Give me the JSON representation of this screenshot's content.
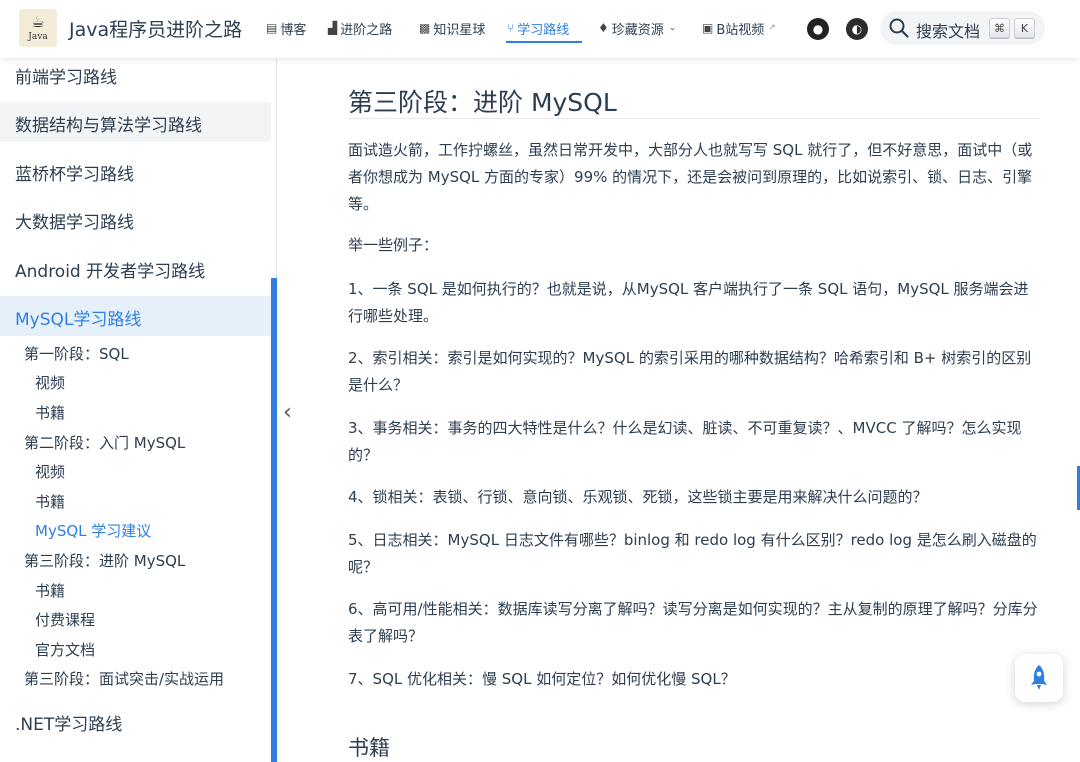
{
  "navbar": {
    "logo_text": "Java",
    "site_title": "Java程序员进阶之路",
    "items": [
      {
        "label": "博客",
        "icon": "document-icon"
      },
      {
        "label": "进阶之路",
        "icon": "chart-icon"
      },
      {
        "label": "知识星球",
        "icon": "planet-icon"
      },
      {
        "label": "学习路线",
        "icon": "path-icon"
      },
      {
        "label": "珍藏资源",
        "icon": "diamond-icon"
      },
      {
        "label": "B站视频",
        "icon": "tv-icon"
      }
    ],
    "search_label": "搜索文档",
    "search_keys": [
      "⌘",
      "K"
    ],
    "accent_color": "#2f7fe0"
  },
  "sidebar": {
    "links": [
      "前端学习路线",
      "数据结构与算法学习路线",
      "蓝桥杯学习路线",
      "大数据学习路线",
      "Android 开发者学习路线",
      "MySQL学习路线",
      ".NET学习路线"
    ],
    "sub_items": [
      "第一阶段：SQL",
      "视频",
      "书籍",
      "第二阶段：入门 MySQL",
      "视频",
      "书籍",
      "MySQL 学习建议",
      "第三阶段：进阶 MySQL",
      "书籍",
      "付费课程",
      "官方文档",
      "第三阶段：面试突击/实战运用"
    ]
  },
  "main": {
    "heading": "第三阶段：进阶 MySQL",
    "intro": "面试造火箭，工作拧螺丝，虽然日常开发中，大部分人也就写写 SQL 就行了，但不好意思，面试中（或者你想成为 MySQL 方面的专家）99% 的情况下，还是会被问到原理的，比如说索引、锁、日志、引擎等。",
    "examples_label": "举一些例子：",
    "items": [
      "1、一条 SQL 是如何执行的？也就是说，从MySQL 客户端执行了一条 SQL 语句，MySQL 服务端会进行哪些处理。",
      "2、索引相关：索引是如何实现的？MySQL 的索引采用的哪种数据结构？哈希索引和 B+ 树索引的区别是什么？",
      "3、事务相关：事务的四大特性是什么？什么是幻读、脏读、不可重复读？、MVCC 了解吗？怎么实现的？",
      "4、锁相关：表锁、行锁、意向锁、乐观锁、死锁，这些锁主要是用来解决什么问题的？",
      "5、日志相关：MySQL 日志文件有哪些？binlog 和 redo log 有什么区别？redo log 是怎么刷入磁盘的呢？",
      "6、高可用/性能相关：数据库读写分离了解吗？读写分离是如何实现的？主从复制的原理了解吗？分库分表了解吗？",
      "7、SQL 优化相关：慢 SQL 如何定位？如何优化慢 SQL？"
    ],
    "next_heading": "书籍"
  }
}
